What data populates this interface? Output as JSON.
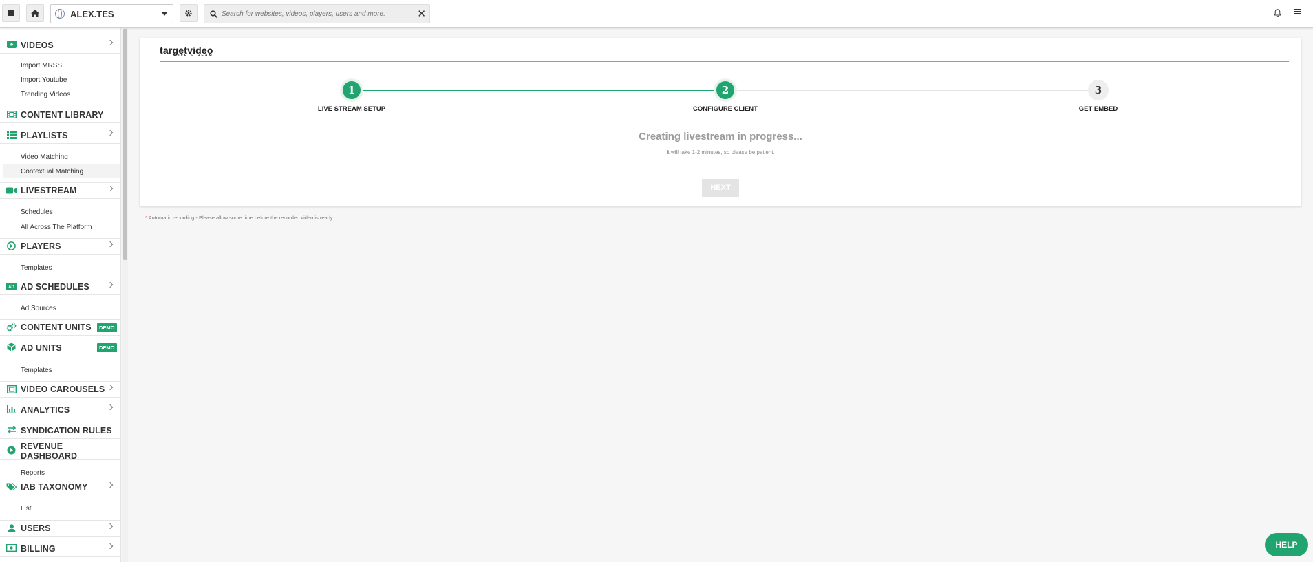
{
  "topbar": {
    "site_name": "ALEX.TES",
    "search_placeholder": "Search for websites, videos, players, users and more."
  },
  "sidebar": {
    "videos": {
      "label": "VIDEOS",
      "subs": [
        "Import MRSS",
        "Import Youtube",
        "Trending Videos"
      ]
    },
    "content_library": {
      "label": "CONTENT LIBRARY"
    },
    "playlists": {
      "label": "PLAYLISTS",
      "subs": [
        "Video Matching",
        "Contextual Matching"
      ]
    },
    "livestream": {
      "label": "LIVESTREAM",
      "subs": [
        "Schedules",
        "All Across The Platform"
      ]
    },
    "players": {
      "label": "PLAYERS",
      "subs": [
        "Templates"
      ]
    },
    "ad_schedules": {
      "label": "AD SCHEDULES",
      "subs": [
        "Ad Sources"
      ]
    },
    "content_units": {
      "label": "CONTENT UNITS",
      "badge": "DEMO"
    },
    "ad_units": {
      "label": "AD UNITS",
      "badge": "DEMO",
      "subs": [
        "Templates"
      ]
    },
    "video_carousels": {
      "label": "VIDEO CAROUSELS"
    },
    "analytics": {
      "label": "ANALYTICS"
    },
    "syndication_rules": {
      "label": "SYNDICATION RULES"
    },
    "revenue_dashboard": {
      "label": "REVENUE DASHBOARD",
      "subs": [
        "Reports"
      ]
    },
    "iab_taxonomy": {
      "label": "IAB TAXONOMY",
      "subs": [
        "List"
      ]
    },
    "users": {
      "label": "USERS"
    },
    "billing": {
      "label": "BILLING"
    }
  },
  "brand": {
    "name": "targetvideo",
    "sub": "LIVE STREAM"
  },
  "steps": [
    {
      "number": "1",
      "label": "LIVE STREAM SETUP"
    },
    {
      "number": "2",
      "label": "CONFIGURE CLIENT"
    },
    {
      "number": "3",
      "label": "GET EMBED"
    }
  ],
  "progress": {
    "title": "Creating livestream in progress...",
    "subtitle": "It will take 1-2 minutes, so please be patient."
  },
  "next_label": "NEXT",
  "note": {
    "asterisk": "*",
    "text": " Automatic recording - Please allow some time before the recorded video is ready"
  },
  "help_label": "HELP",
  "colors": {
    "accent": "#22a470",
    "step_inactive": "#eeeeee"
  }
}
